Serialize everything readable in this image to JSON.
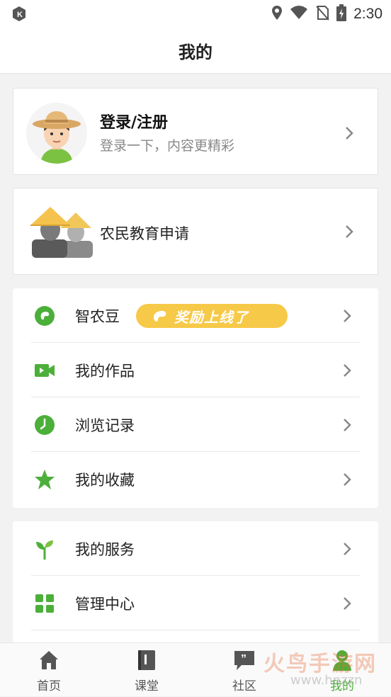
{
  "status_bar": {
    "time": "2:30"
  },
  "header": {
    "title": "我的"
  },
  "profile": {
    "login_title": "登录/注册",
    "login_subtitle": "登录一下，内容更精彩"
  },
  "apply": {
    "label": "农民教育申请"
  },
  "list1": {
    "items": [
      {
        "label": "智农豆",
        "icon": "bean-icon",
        "badge": "奖励上线了"
      },
      {
        "label": "我的作品",
        "icon": "video-icon"
      },
      {
        "label": "浏览记录",
        "icon": "clock-icon"
      },
      {
        "label": "我的收藏",
        "icon": "star-icon"
      }
    ]
  },
  "list2": {
    "items": [
      {
        "label": "我的服务",
        "icon": "sprout-icon"
      },
      {
        "label": "管理中心",
        "icon": "grid-icon"
      }
    ]
  },
  "tabs": [
    {
      "label": "首页",
      "icon": "home-icon"
    },
    {
      "label": "课堂",
      "icon": "book-icon"
    },
    {
      "label": "社区",
      "icon": "chat-icon"
    },
    {
      "label": "我的",
      "icon": "profile-icon",
      "active": true
    }
  ],
  "watermark": {
    "text": "火鸟手游网",
    "sub": "www.hnzzn"
  },
  "colors": {
    "accent": "#4caf3a",
    "badge": "#f7c948"
  }
}
